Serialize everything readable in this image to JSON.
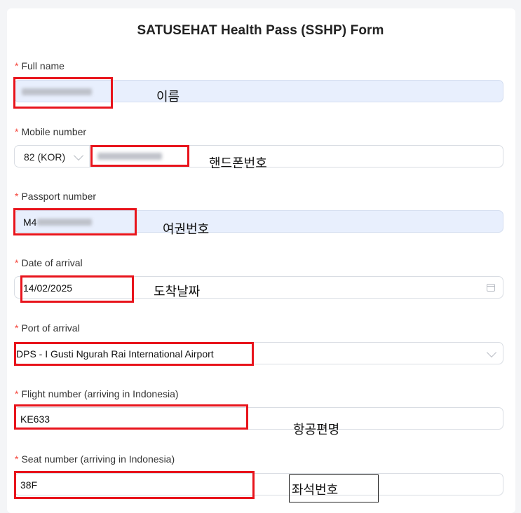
{
  "form": {
    "title": "SATUSEHAT Health Pass (SSHP) Form",
    "required_mark": "*",
    "full_name": {
      "label": "Full name",
      "note": "이름"
    },
    "mobile": {
      "label": "Mobile number",
      "country_code": "82 (KOR)",
      "note": "핸드폰번호"
    },
    "passport": {
      "label": "Passport number",
      "value_prefix": "M4",
      "note": "여권번호"
    },
    "arrival_date": {
      "label": "Date of arrival",
      "value": "14/02/2025",
      "note": "도착날짜"
    },
    "port": {
      "label": "Port of arrival",
      "value": "DPS - I Gusti Ngurah Rai International Airport"
    },
    "flight": {
      "label": "Flight number (arriving in Indonesia)",
      "value": "KE633",
      "note": "항공편명"
    },
    "seat": {
      "label": "Seat number (arriving in Indonesia)",
      "value": "38F",
      "note": "좌석번호"
    }
  },
  "colors": {
    "annotation_red": "#e8141c",
    "required_red": "#f5463c",
    "filled_background": "#e8effd"
  },
  "icons": {
    "dropdown": "chevron-down-icon",
    "date": "calendar-icon"
  }
}
